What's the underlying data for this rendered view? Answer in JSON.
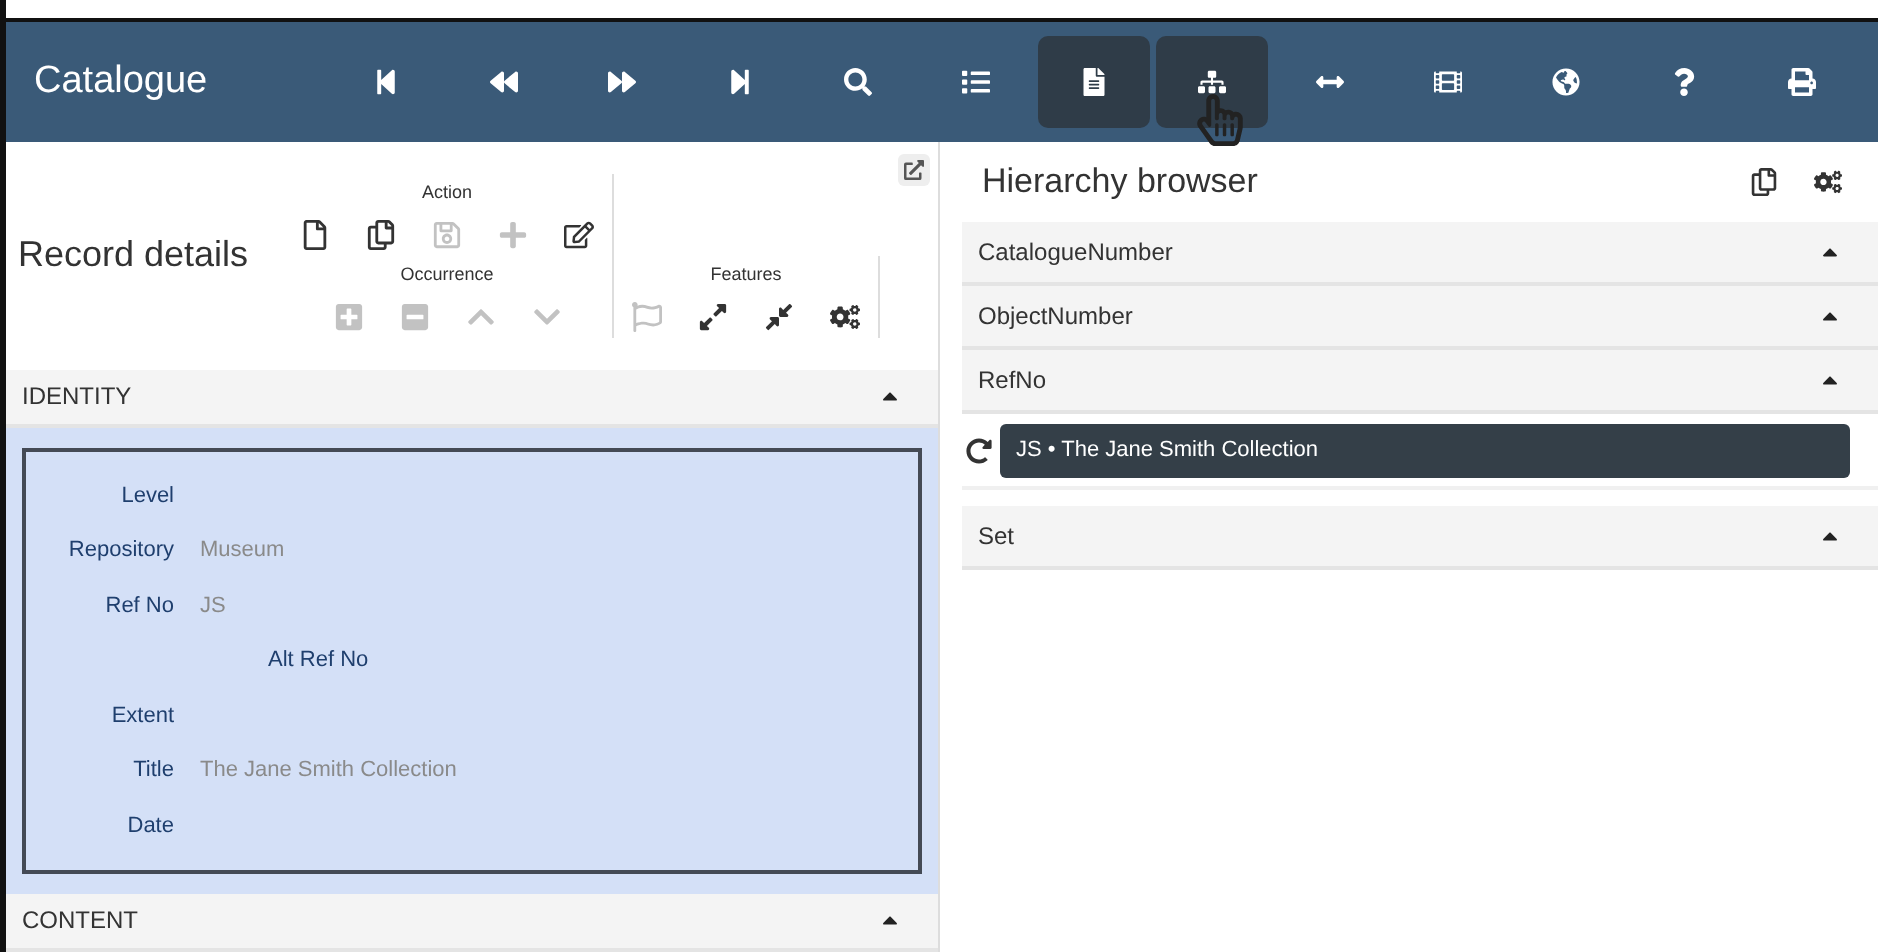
{
  "toolbar": {
    "title": "Catalogue",
    "tools": [
      {
        "kind": "first",
        "selected": false
      },
      {
        "kind": "previous",
        "selected": false
      },
      {
        "kind": "next",
        "selected": false
      },
      {
        "kind": "last",
        "selected": false
      },
      {
        "kind": "search",
        "selected": false
      },
      {
        "kind": "list",
        "selected": false
      },
      {
        "kind": "record",
        "selected": true
      },
      {
        "kind": "hierarchy",
        "selected": true
      },
      {
        "kind": "compare",
        "selected": false
      },
      {
        "kind": "media",
        "selected": false
      },
      {
        "kind": "web",
        "selected": false
      },
      {
        "kind": "help",
        "selected": false
      },
      {
        "kind": "print",
        "selected": false
      }
    ]
  },
  "record_panel": {
    "title": "Record details",
    "groups": [
      {
        "label": "Action",
        "tools": [
          {
            "kind": "new",
            "disabled": false
          },
          {
            "kind": "copy",
            "disabled": false
          },
          {
            "kind": "save",
            "disabled": true
          },
          {
            "kind": "add",
            "disabled": true
          },
          {
            "kind": "edit",
            "disabled": false
          }
        ]
      },
      {
        "label": "Occurrence",
        "tools": [
          {
            "kind": "add-occurrence",
            "disabled": true
          },
          {
            "kind": "remove-occurrence",
            "disabled": true
          },
          {
            "kind": "up",
            "disabled": true
          },
          {
            "kind": "down",
            "disabled": true
          }
        ]
      },
      {
        "label": "Features",
        "tools": [
          {
            "kind": "flag",
            "disabled": true
          },
          {
            "kind": "expand",
            "disabled": false
          },
          {
            "kind": "collapse",
            "disabled": false
          },
          {
            "kind": "settings",
            "disabled": false
          }
        ]
      }
    ],
    "sections": [
      {
        "title": "IDENTITY",
        "fields": [
          {
            "kind": "field",
            "label": "Level"
          },
          {
            "kind": "field",
            "label": "Repository",
            "value": "Museum"
          },
          {
            "kind": "field",
            "label": "Ref No",
            "value": "JS"
          },
          {
            "kind": "subfield",
            "label": "Alt Ref No"
          },
          {
            "kind": "field",
            "label": "Extent"
          },
          {
            "kind": "field",
            "label": "Title",
            "value": "The Jane Smith Collection"
          },
          {
            "kind": "field",
            "label": "Date"
          }
        ]
      },
      {
        "title": "CONTENT"
      }
    ]
  },
  "hierarchy_panel": {
    "title": "Hierarchy browser",
    "sections": [
      {
        "title": "CatalogueNumber"
      },
      {
        "title": "ObjectNumber"
      },
      {
        "title": "RefNo",
        "nodes": [
          "JS • The Jane Smith Collection"
        ]
      },
      {
        "title": "Set"
      }
    ]
  }
}
